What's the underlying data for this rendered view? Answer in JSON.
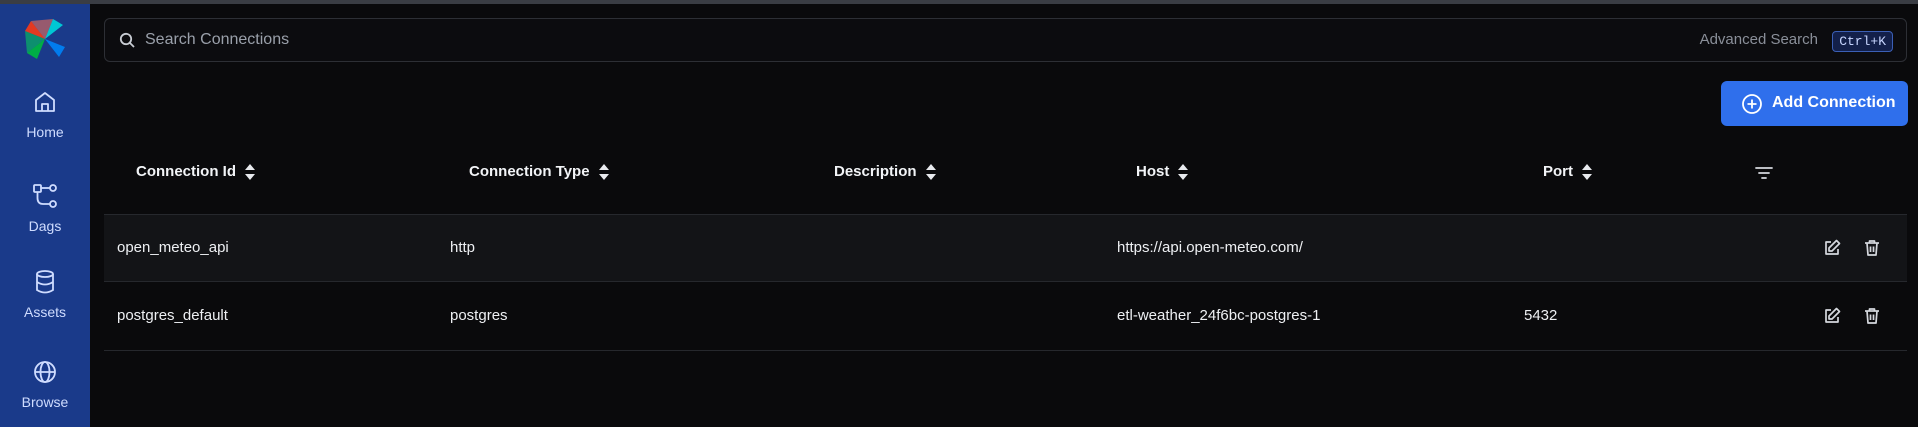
{
  "sidebar": {
    "logo": "airflow-pinwheel-logo",
    "items": [
      {
        "label": "Home",
        "icon": "home-icon"
      },
      {
        "label": "Dags",
        "icon": "dags-icon"
      },
      {
        "label": "Assets",
        "icon": "database-icon"
      },
      {
        "label": "Browse",
        "icon": "globe-icon"
      }
    ]
  },
  "search": {
    "placeholder": "Search Connections",
    "advanced_label": "Advanced Search",
    "shortcut": "Ctrl+K"
  },
  "toolbar": {
    "add_label": "Add Connection"
  },
  "table": {
    "columns": [
      "Connection Id",
      "Connection Type",
      "Description",
      "Host",
      "Port"
    ],
    "rows": [
      {
        "id": "open_meteo_api",
        "type": "http",
        "description": "",
        "host": "https://api.open-meteo.com/",
        "port": ""
      },
      {
        "id": "postgres_default",
        "type": "postgres",
        "description": "",
        "host": "etl-weather_24f6bc-postgres-1",
        "port": "5432"
      }
    ]
  },
  "colors": {
    "sidebar": "#1a3a8a",
    "accent": "#2f6fec",
    "background": "#0a0a0c"
  }
}
